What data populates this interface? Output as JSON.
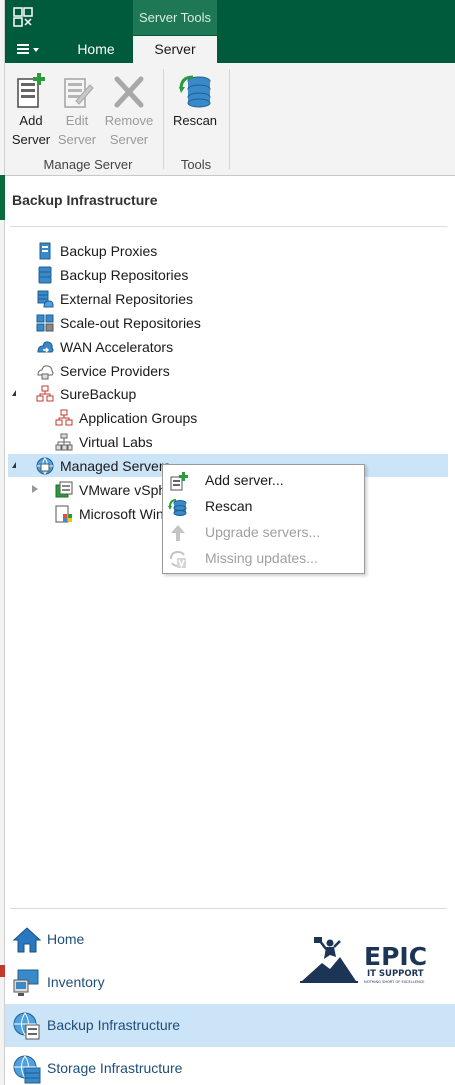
{
  "ribbon": {
    "context_tab_header": "Server Tools",
    "tabs": [
      {
        "label": "Home"
      },
      {
        "label": "Server"
      }
    ],
    "buttons": [
      {
        "line1": "Add",
        "line2": "Server",
        "icon": "add-server-icon",
        "enabled": true
      },
      {
        "line1": "Edit",
        "line2": "Server",
        "icon": "edit-server-icon",
        "enabled": false
      },
      {
        "line1": "Remove",
        "line2": "Server",
        "icon": "remove-server-icon",
        "enabled": false
      },
      {
        "line1": "Rescan",
        "line2": "",
        "icon": "rescan-icon",
        "enabled": true
      }
    ],
    "groups": [
      {
        "label": "Manage Server"
      },
      {
        "label": "Tools"
      }
    ]
  },
  "pane": {
    "title": "Backup Infrastructure"
  },
  "tree": [
    {
      "label": "Backup Proxies",
      "icon": "backup-proxy-icon"
    },
    {
      "label": "Backup Repositories",
      "icon": "backup-repository-icon"
    },
    {
      "label": "External Repositories",
      "icon": "external-repository-icon"
    },
    {
      "label": "Scale-out Repositories",
      "icon": "scale-out-repository-icon"
    },
    {
      "label": "WAN Accelerators",
      "icon": "wan-accelerator-icon"
    },
    {
      "label": "Service Providers",
      "icon": "service-provider-icon"
    },
    {
      "label": "SureBackup",
      "icon": "surebackup-icon"
    },
    {
      "label": "Application Groups",
      "icon": "application-group-icon"
    },
    {
      "label": "Virtual Labs",
      "icon": "virtual-lab-icon"
    },
    {
      "label": "Managed Servers",
      "icon": "managed-servers-icon"
    },
    {
      "label": "VMware vSphere",
      "icon": "vmware-vsphere-icon"
    },
    {
      "label": "Microsoft Windows",
      "icon": "microsoft-windows-icon"
    }
  ],
  "context_menu": [
    {
      "label": "Add server...",
      "icon": "add-server-icon",
      "enabled": true
    },
    {
      "label": "Rescan",
      "icon": "rescan-icon",
      "enabled": true
    },
    {
      "label": "Upgrade servers...",
      "icon": "upgrade-arrow-icon",
      "enabled": false
    },
    {
      "label": "Missing updates...",
      "icon": "missing-updates-icon",
      "enabled": false
    }
  ],
  "nav": [
    {
      "label": "Home",
      "icon": "home-icon",
      "active": false
    },
    {
      "label": "Inventory",
      "icon": "inventory-icon",
      "active": false
    },
    {
      "label": "Backup Infrastructure",
      "icon": "backup-infrastructure-icon",
      "active": true
    },
    {
      "label": "Storage Infrastructure",
      "icon": "storage-infrastructure-icon",
      "active": false
    }
  ],
  "logo": {
    "title": "EPIC",
    "subtitle": "IT SUPPORT",
    "tagline": "NOTHING SHORT OF EXCELLENCE"
  },
  "colors": {
    "brand_green": "#005a3c",
    "selection_blue": "#cce4f7",
    "logo_navy": "#1c3557"
  }
}
